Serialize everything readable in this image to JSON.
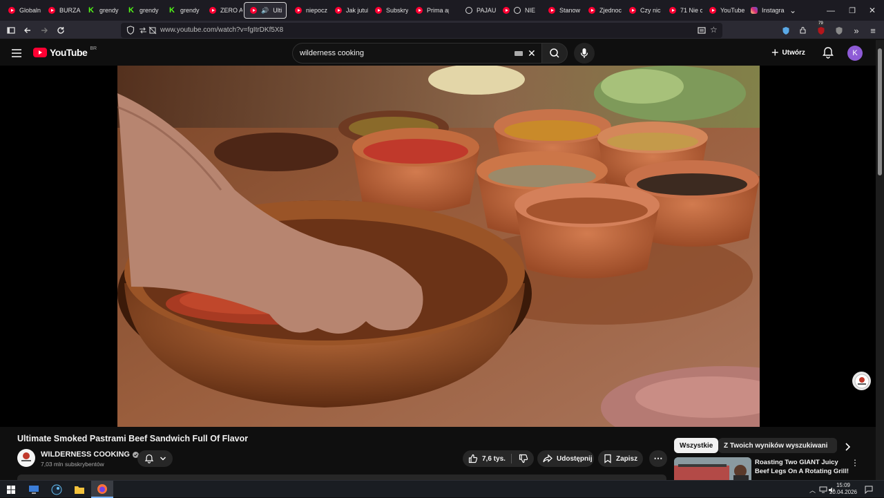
{
  "browser": {
    "tabs": [
      {
        "label": "Globaln",
        "icon": "youtube-icon"
      },
      {
        "label": "BURZA",
        "icon": "youtube-icon"
      },
      {
        "label": "grendy",
        "icon": "kick-icon"
      },
      {
        "label": "grendy",
        "icon": "kick-icon"
      },
      {
        "label": "grendy",
        "icon": "kick-icon"
      },
      {
        "label": "ZERO AI",
        "icon": "youtube-icon"
      },
      {
        "label": "Ulti",
        "icon": "speaker-icon",
        "active": true
      },
      {
        "label": "niepocz",
        "icon": "youtube-icon"
      },
      {
        "label": "Jak jutul",
        "icon": "youtube-icon"
      },
      {
        "label": "Subskry",
        "icon": "youtube-icon"
      },
      {
        "label": "Prima ap",
        "icon": "youtube-icon"
      },
      {
        "label": "PAJAU",
        "icon": "circle-icon"
      },
      {
        "label": "NIE M",
        "icon": "youtube-icon"
      },
      {
        "label": "Stanow",
        "icon": "youtube-icon"
      },
      {
        "label": "Zjednoc",
        "icon": "youtube-icon"
      },
      {
        "label": "Czy nic",
        "icon": "youtube-icon"
      },
      {
        "label": "71 Nie c",
        "icon": "youtube-icon"
      },
      {
        "label": "YouTube",
        "icon": "youtube-icon"
      },
      {
        "label": "Instagra",
        "icon": "instagram-icon"
      }
    ],
    "url": "www.youtube.com/watch?v=fgItrDKf5X8",
    "extension_badge": "79"
  },
  "youtube": {
    "logo_text": "YouTube",
    "region": "BR",
    "search_value": "wilderness cooking",
    "create_label": "Utwórz",
    "avatar_letter": "K"
  },
  "video": {
    "title": "Ultimate Smoked Pastrami Beef Sandwich Full Of Flavor",
    "channel_name": "WILDERNESS COOKING",
    "subscribers": "7,03 mln subskrybentów",
    "likes": "7,6 tys.",
    "share_label": "Udostępnij",
    "save_label": "Zapisz",
    "channel_logo_text": "WILDERNESS COOKING"
  },
  "sidebar": {
    "chips": [
      "Wszystkie",
      "Z Twoich wyników wyszukiwania"
    ],
    "recommended": {
      "title": "Roasting Two GIANT Juicy Beef Legs On A Rotating Grill!"
    }
  },
  "taskbar": {
    "time": "15:09",
    "date": "20.04.2026"
  },
  "colors": {
    "youtube_red": "#ff0033",
    "avatar_bg": "#8e5bd6",
    "page_bg": "#0f0f0f"
  }
}
